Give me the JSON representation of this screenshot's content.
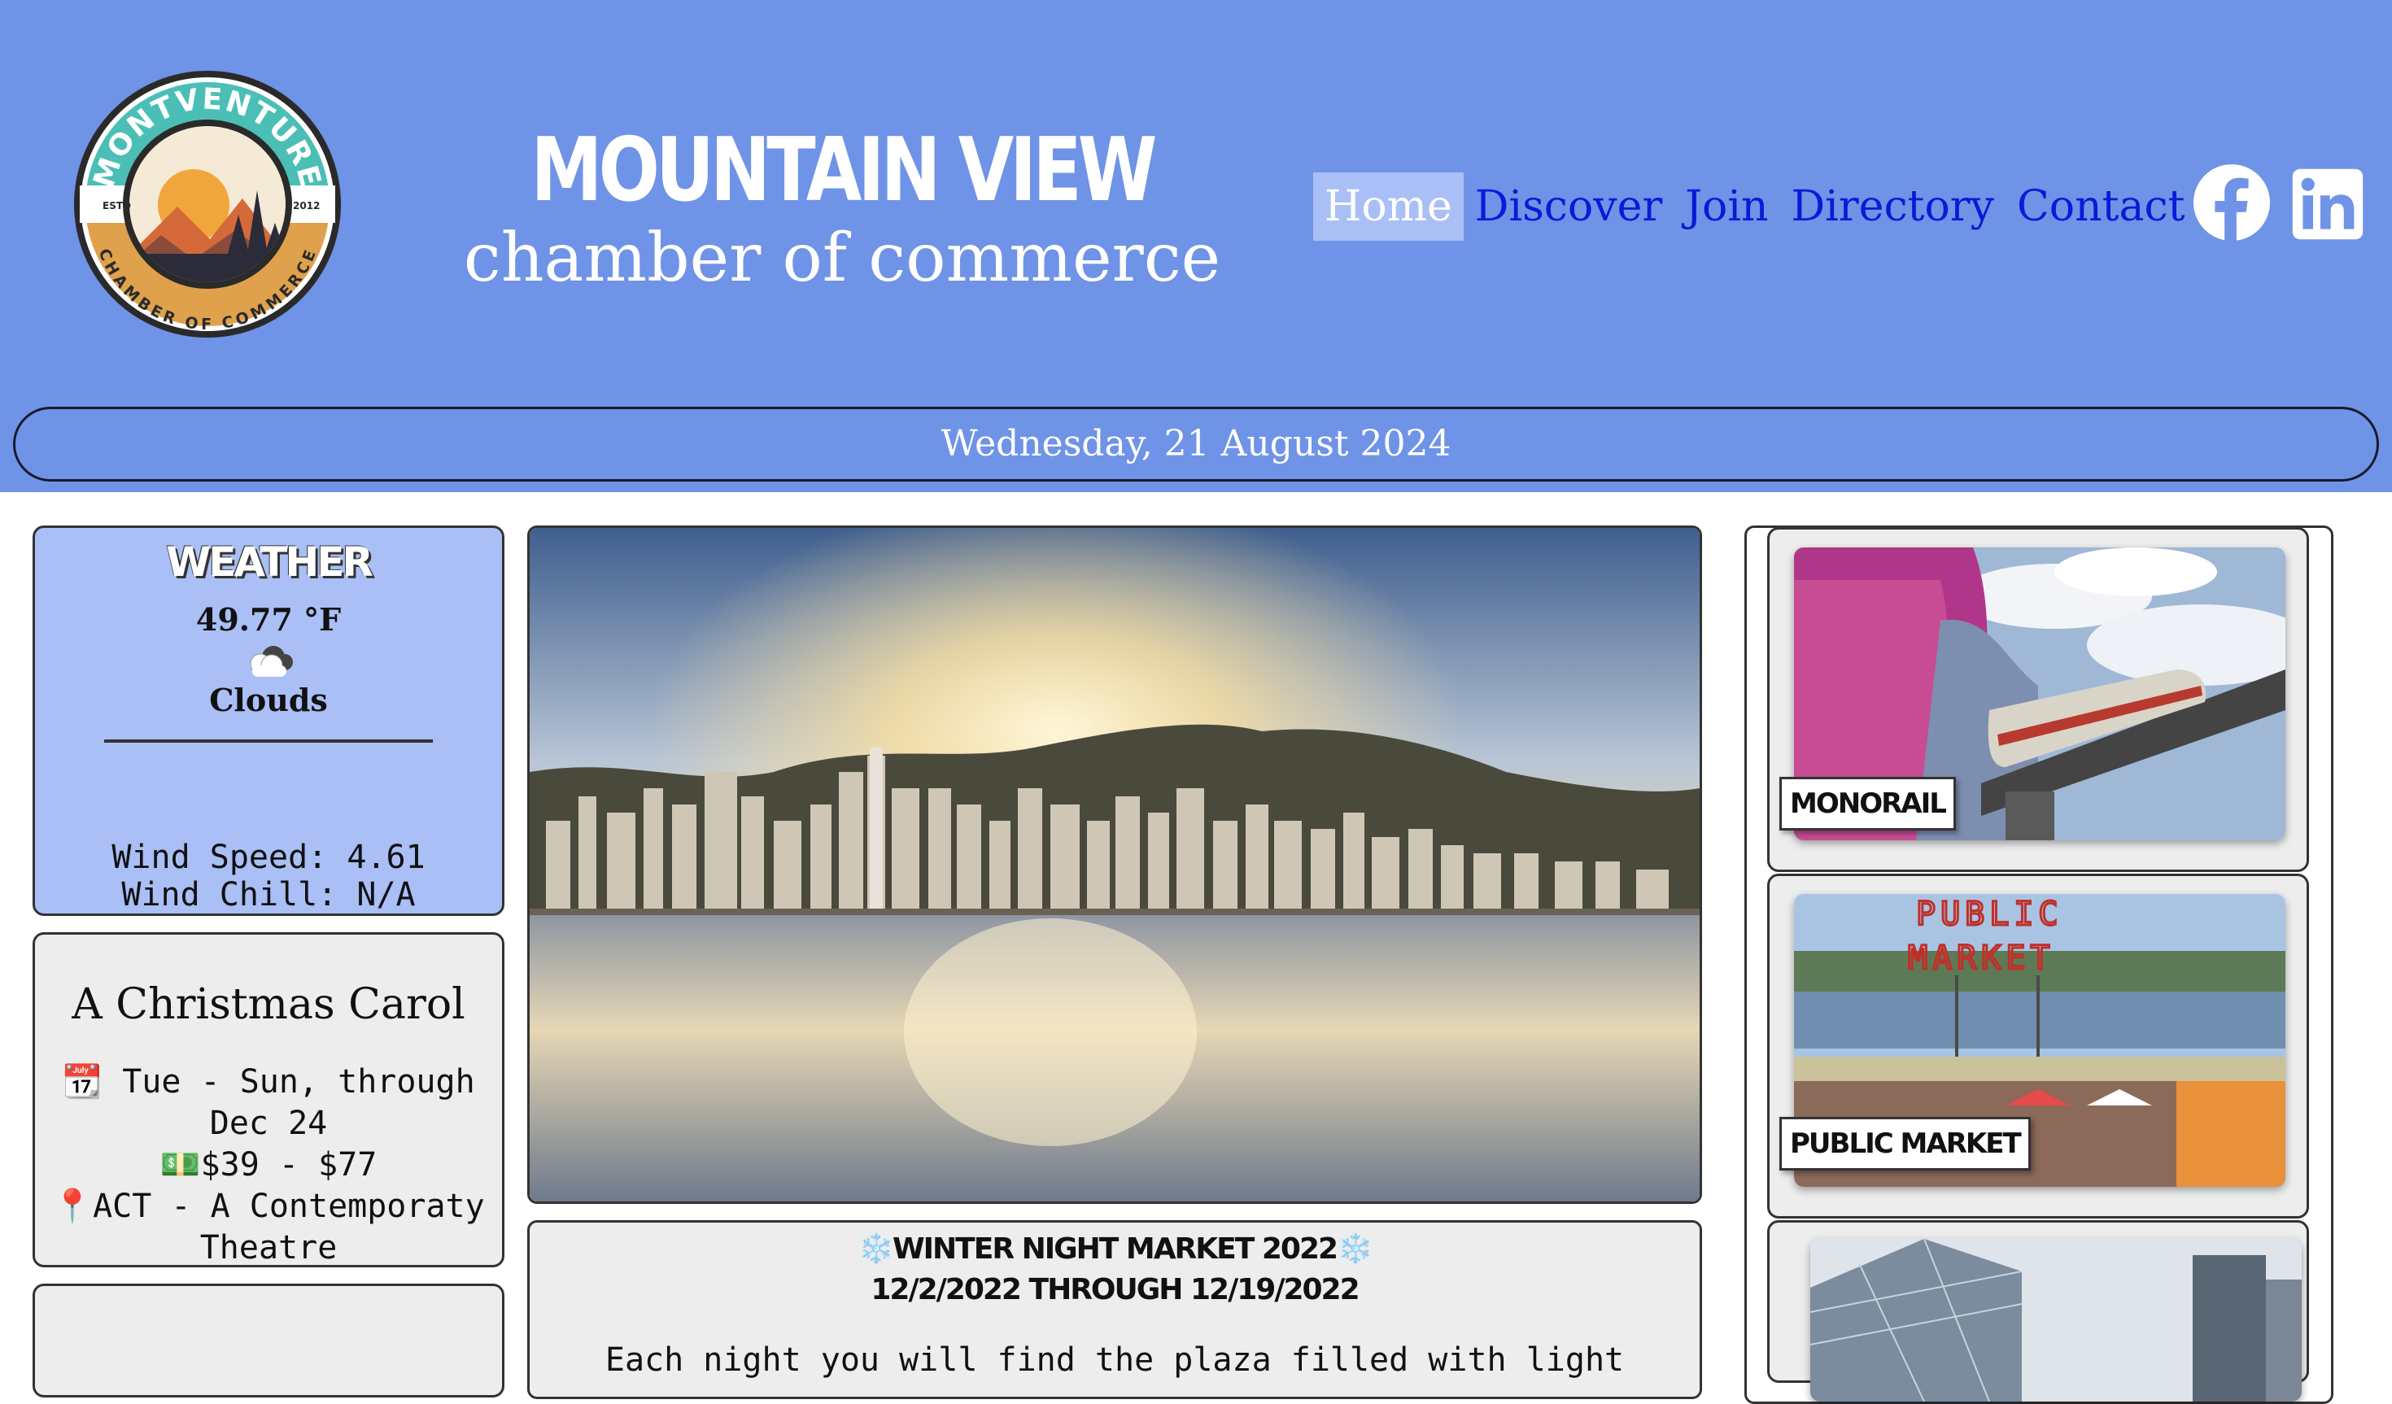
{
  "header": {
    "logo": {
      "arc_top": "MONTVENTURE",
      "arc_bottom": "CHAMBER OF COMMERCE",
      "estd_label": "ESTD",
      "estd_year": "2012"
    },
    "title_main": "MOUNTAIN VIEW",
    "title_sub": "chamber of commerce",
    "nav": [
      {
        "label": "Home",
        "active": true
      },
      {
        "label": "Discover",
        "active": false
      },
      {
        "label": "Join",
        "active": false
      },
      {
        "label": "Directory",
        "active": false
      },
      {
        "label": "Contact",
        "active": false
      }
    ],
    "social": [
      "facebook-icon",
      "linkedin-icon"
    ],
    "date": "Wednesday, 21 August 2024"
  },
  "weather": {
    "title": "WEATHER",
    "temperature": "49.77 °F",
    "icon": "cloud-icon",
    "condition": "Clouds",
    "wind_speed": "Wind Speed: 4.61",
    "wind_chill": "Wind Chill: N/A"
  },
  "event": {
    "title": "A Christmas Carol",
    "schedule_icon": "📆",
    "schedule": "Tue - Sun, through Dec 24",
    "price_icon": "💵",
    "price": "$39 - $77",
    "location_icon": "📍",
    "location": "ACT - A Contemporaty Theatre"
  },
  "market": {
    "snow_icon": "❄️",
    "title": "WINTER NIGHT MARKET 2022",
    "dates": "12/2/2022 THROUGH 12/19/2022",
    "text": "Each night you will find the plaza filled with light"
  },
  "features": [
    {
      "label": "MONORAIL"
    },
    {
      "label": "PUBLIC MARKET"
    },
    {
      "label": ""
    }
  ],
  "colors": {
    "header_bg": "#6f93e6",
    "nav_link": "#0a1ad8",
    "nav_active_bg": "#a9bff5",
    "weather_bg": "#a9bff5",
    "card_bg": "#ededed"
  }
}
